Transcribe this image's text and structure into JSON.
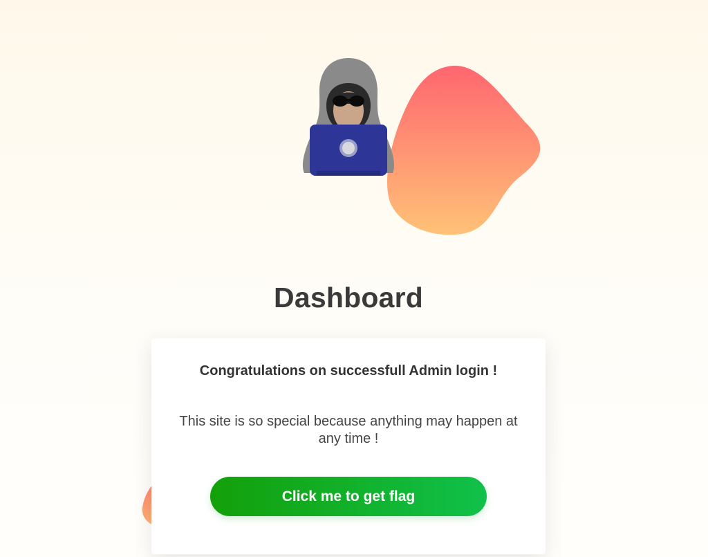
{
  "page": {
    "title": "Dashboard"
  },
  "illustration": {
    "name": "hacker-with-laptop-icon"
  },
  "card": {
    "heading": "Congratulations on successfull Admin login !",
    "message": "This site is so special because anything may happen at any time !",
    "button_label": "Click me to get flag"
  },
  "colors": {
    "background_top": "#fff8ea",
    "blob_gradient_top": "#ff6670",
    "blob_gradient_bottom": "#ffc277",
    "button_gradient_start": "#13a00a",
    "button_gradient_end": "#10c14a",
    "title_text": "#3a3a3a"
  }
}
